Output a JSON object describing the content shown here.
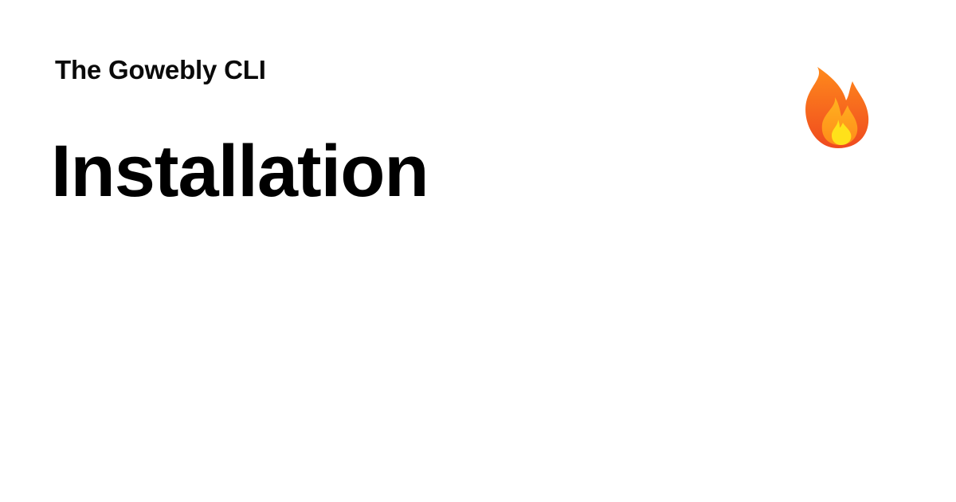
{
  "header": {
    "subtitle": "The Gowebly CLI",
    "title": "Installation"
  },
  "emoji": {
    "icon": "fire-icon"
  },
  "colors": {
    "background": "#ffffff",
    "text": "#000000",
    "flame_outer": "#f25c1e",
    "flame_mid": "#ff9a1f",
    "flame_inner": "#ffe11a"
  }
}
